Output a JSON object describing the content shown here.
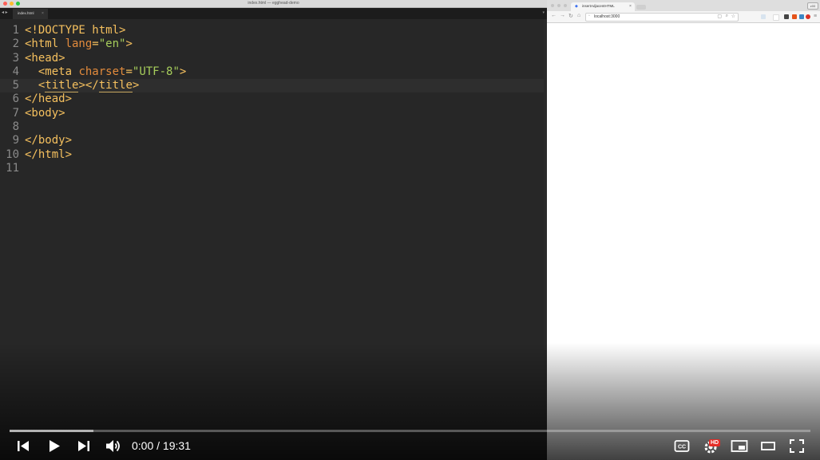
{
  "editor": {
    "window_title": "index.html — egghead-demo",
    "tab_label": "index.html",
    "tab_close": "×",
    "lines": [
      {
        "n": "1",
        "parts": [
          {
            "c": "t",
            "v": "<!DOCTYPE html>"
          }
        ]
      },
      {
        "n": "2",
        "parts": [
          {
            "c": "t",
            "v": "<html "
          },
          {
            "c": "a",
            "v": "lang"
          },
          {
            "c": "t",
            "v": "="
          },
          {
            "c": "s",
            "v": "\"en\""
          },
          {
            "c": "t",
            "v": ">"
          }
        ]
      },
      {
        "n": "3",
        "parts": [
          {
            "c": "t",
            "v": "<head>"
          }
        ]
      },
      {
        "n": "4",
        "parts": [
          {
            "c": "t",
            "v": "  <meta "
          },
          {
            "c": "a",
            "v": "charset"
          },
          {
            "c": "t",
            "v": "="
          },
          {
            "c": "s",
            "v": "\"UTF-8\""
          },
          {
            "c": "t",
            "v": ">"
          }
        ]
      },
      {
        "n": "5",
        "parts": [
          {
            "c": "t",
            "v": "  <"
          },
          {
            "c": "tu",
            "v": "title"
          },
          {
            "c": "t",
            "v": "></"
          },
          {
            "c": "tu",
            "v": "title"
          },
          {
            "c": "t",
            "v": ">"
          }
        ],
        "current": true
      },
      {
        "n": "6",
        "parts": [
          {
            "c": "t",
            "v": "</head>"
          }
        ]
      },
      {
        "n": "7",
        "parts": [
          {
            "c": "t",
            "v": "<body>"
          }
        ]
      },
      {
        "n": "8",
        "parts": []
      },
      {
        "n": "9",
        "parts": [
          {
            "c": "t",
            "v": "</body>"
          }
        ]
      },
      {
        "n": "10",
        "parts": [
          {
            "c": "t",
            "v": "</html>"
          }
        ]
      },
      {
        "n": "11",
        "parts": []
      }
    ]
  },
  "browser": {
    "tab_title": "insertAdjacentHTML",
    "tab_close": "×",
    "zoom": "z00",
    "url": "localhost:3000"
  },
  "player": {
    "time_current": "0:00",
    "time_separator": " / ",
    "time_total": "19:31",
    "progress_played": 0.0,
    "progress_loaded": 0.105,
    "hd_badge": "HD"
  },
  "colors": {
    "editor_bg": "#272727",
    "tag": "#f5c05e",
    "attr": "#e38b3c",
    "string": "#a6cd5b",
    "progress_red": "#ff0000"
  }
}
